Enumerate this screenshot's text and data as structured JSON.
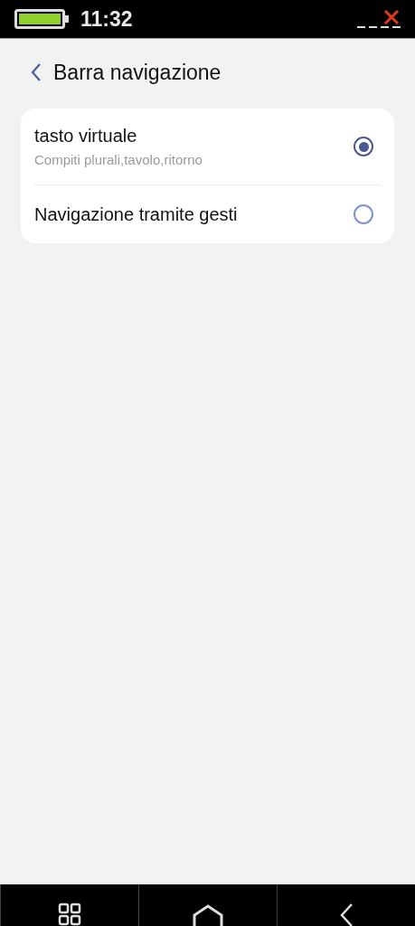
{
  "status_bar": {
    "time": "11:32"
  },
  "header": {
    "title": "Barra navigazione"
  },
  "options": [
    {
      "label": "tasto virtuale",
      "description": "Compiti plurali,tavolo,ritorno",
      "selected": true
    },
    {
      "label": "Navigazione tramite gesti",
      "selected": false
    }
  ]
}
